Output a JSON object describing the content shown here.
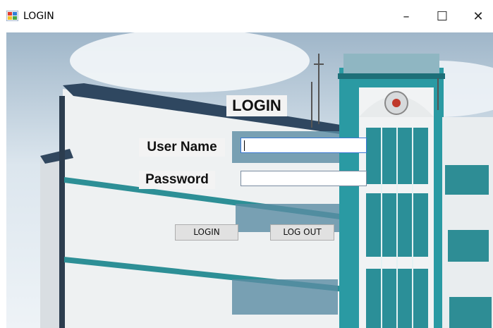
{
  "window": {
    "title": "LOGIN",
    "minimize_glyph": "–",
    "maximize_glyph": "☐",
    "close_glyph": "✕",
    "icon": "form-app-icon"
  },
  "form": {
    "heading": "LOGIN",
    "username_label": "User Name",
    "username_value": "",
    "password_label": "Password",
    "password_value": "",
    "login_button": "LOGIN",
    "logout_button": "LOG OUT"
  },
  "background": {
    "image": "building-photo",
    "colors": {
      "sky": "#e6eef4",
      "teal": "#2a9aa3",
      "wall": "#eef1f3"
    }
  }
}
